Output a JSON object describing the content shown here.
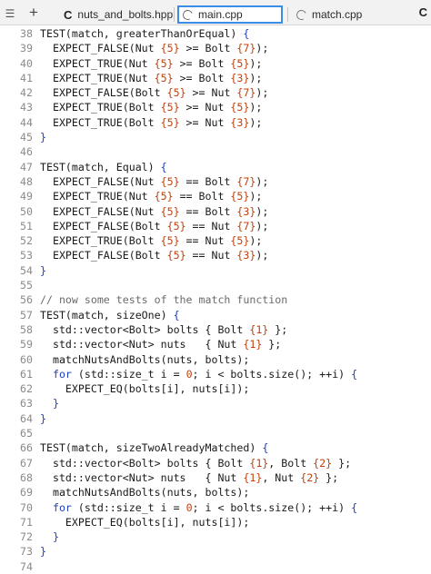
{
  "tabs": {
    "grip_glyph": "☰",
    "add_glyph": "+",
    "items": [
      {
        "label": "nuts_and_bolts.hpp",
        "icon": "c-language-icon"
      },
      {
        "label": "main.cpp",
        "icon": "loading-ring-icon",
        "active": true
      },
      {
        "label": "match.cpp",
        "icon": "loading-ring-icon"
      }
    ],
    "overflow_glyph": "C"
  },
  "editor": {
    "lines": [
      {
        "n": "38",
        "segs": [
          {
            "t": "TEST(match, greaterThanOrEqual) "
          },
          {
            "t": "{",
            "c": "brace"
          }
        ]
      },
      {
        "n": "39",
        "segs": [
          {
            "t": "  EXPECT_FALSE(Nut "
          },
          {
            "t": "{5}",
            "c": "num"
          },
          {
            "t": " >= Bolt "
          },
          {
            "t": "{7}",
            "c": "num"
          },
          {
            "t": ");"
          }
        ]
      },
      {
        "n": "40",
        "segs": [
          {
            "t": "  EXPECT_TRUE(Nut "
          },
          {
            "t": "{5}",
            "c": "num"
          },
          {
            "t": " >= Bolt "
          },
          {
            "t": "{5}",
            "c": "num"
          },
          {
            "t": ");"
          }
        ]
      },
      {
        "n": "41",
        "segs": [
          {
            "t": "  EXPECT_TRUE(Nut "
          },
          {
            "t": "{5}",
            "c": "num"
          },
          {
            "t": " >= Bolt "
          },
          {
            "t": "{3}",
            "c": "num"
          },
          {
            "t": ");"
          }
        ]
      },
      {
        "n": "42",
        "segs": [
          {
            "t": "  EXPECT_FALSE(Bolt "
          },
          {
            "t": "{5}",
            "c": "num"
          },
          {
            "t": " >= Nut "
          },
          {
            "t": "{7}",
            "c": "num"
          },
          {
            "t": ");"
          }
        ]
      },
      {
        "n": "43",
        "segs": [
          {
            "t": "  EXPECT_TRUE(Bolt "
          },
          {
            "t": "{5}",
            "c": "num"
          },
          {
            "t": " >= Nut "
          },
          {
            "t": "{5}",
            "c": "num"
          },
          {
            "t": ");"
          }
        ]
      },
      {
        "n": "44",
        "segs": [
          {
            "t": "  EXPECT_TRUE(Bolt "
          },
          {
            "t": "{5}",
            "c": "num"
          },
          {
            "t": " >= Nut "
          },
          {
            "t": "{3}",
            "c": "num"
          },
          {
            "t": ");"
          }
        ]
      },
      {
        "n": "45",
        "segs": [
          {
            "t": "}",
            "c": "brace"
          }
        ]
      },
      {
        "n": "46",
        "segs": []
      },
      {
        "n": "47",
        "segs": [
          {
            "t": "TEST(match, Equal) "
          },
          {
            "t": "{",
            "c": "brace"
          }
        ]
      },
      {
        "n": "48",
        "segs": [
          {
            "t": "  EXPECT_FALSE(Nut "
          },
          {
            "t": "{5}",
            "c": "num"
          },
          {
            "t": " == Bolt "
          },
          {
            "t": "{7}",
            "c": "num"
          },
          {
            "t": ");"
          }
        ]
      },
      {
        "n": "49",
        "segs": [
          {
            "t": "  EXPECT_TRUE(Nut "
          },
          {
            "t": "{5}",
            "c": "num"
          },
          {
            "t": " == Bolt "
          },
          {
            "t": "{5}",
            "c": "num"
          },
          {
            "t": ");"
          }
        ]
      },
      {
        "n": "50",
        "segs": [
          {
            "t": "  EXPECT_FALSE(Nut "
          },
          {
            "t": "{5}",
            "c": "num"
          },
          {
            "t": " == Bolt "
          },
          {
            "t": "{3}",
            "c": "num"
          },
          {
            "t": ");"
          }
        ]
      },
      {
        "n": "51",
        "segs": [
          {
            "t": "  EXPECT_FALSE(Bolt "
          },
          {
            "t": "{5}",
            "c": "num"
          },
          {
            "t": " == Nut "
          },
          {
            "t": "{7}",
            "c": "num"
          },
          {
            "t": ");"
          }
        ]
      },
      {
        "n": "52",
        "segs": [
          {
            "t": "  EXPECT_TRUE(Bolt "
          },
          {
            "t": "{5}",
            "c": "num"
          },
          {
            "t": " == Nut "
          },
          {
            "t": "{5}",
            "c": "num"
          },
          {
            "t": ");"
          }
        ]
      },
      {
        "n": "53",
        "segs": [
          {
            "t": "  EXPECT_FALSE(Bolt "
          },
          {
            "t": "{5}",
            "c": "num"
          },
          {
            "t": " == Nut "
          },
          {
            "t": "{3}",
            "c": "num"
          },
          {
            "t": ");"
          }
        ]
      },
      {
        "n": "54",
        "segs": [
          {
            "t": "}",
            "c": "brace"
          }
        ]
      },
      {
        "n": "55",
        "segs": []
      },
      {
        "n": "56",
        "segs": [
          {
            "t": "// now some tests of the match function",
            "c": "cm"
          }
        ]
      },
      {
        "n": "57",
        "segs": [
          {
            "t": "TEST(match, sizeOne) "
          },
          {
            "t": "{",
            "c": "brace"
          }
        ]
      },
      {
        "n": "58",
        "segs": [
          {
            "t": "  std::vector<Bolt> bolts { Bolt "
          },
          {
            "t": "{1}",
            "c": "num"
          },
          {
            "t": " };"
          }
        ]
      },
      {
        "n": "59",
        "segs": [
          {
            "t": "  std::vector<Nut> nuts   { Nut "
          },
          {
            "t": "{1}",
            "c": "num"
          },
          {
            "t": " };"
          }
        ]
      },
      {
        "n": "60",
        "segs": [
          {
            "t": "  matchNutsAndBolts(nuts, bolts);"
          }
        ]
      },
      {
        "n": "61",
        "segs": [
          {
            "t": "  "
          },
          {
            "t": "for",
            "c": "kw"
          },
          {
            "t": " (std::size_t i = "
          },
          {
            "t": "0",
            "c": "num"
          },
          {
            "t": "; i < bolts.size(); ++i) "
          },
          {
            "t": "{",
            "c": "brace"
          }
        ]
      },
      {
        "n": "62",
        "segs": [
          {
            "t": "    EXPECT_EQ(bolts[i], nuts[i]);"
          }
        ]
      },
      {
        "n": "63",
        "segs": [
          {
            "t": "  "
          },
          {
            "t": "}",
            "c": "brace"
          }
        ]
      },
      {
        "n": "64",
        "segs": [
          {
            "t": "}",
            "c": "brace"
          }
        ]
      },
      {
        "n": "65",
        "segs": []
      },
      {
        "n": "66",
        "segs": [
          {
            "t": "TEST(match, sizeTwoAlreadyMatched) "
          },
          {
            "t": "{",
            "c": "brace"
          }
        ]
      },
      {
        "n": "67",
        "segs": [
          {
            "t": "  std::vector<Bolt> bolts { Bolt "
          },
          {
            "t": "{1}",
            "c": "num"
          },
          {
            "t": ", Bolt "
          },
          {
            "t": "{2}",
            "c": "num"
          },
          {
            "t": " };"
          }
        ]
      },
      {
        "n": "68",
        "segs": [
          {
            "t": "  std::vector<Nut> nuts   { Nut "
          },
          {
            "t": "{1}",
            "c": "num"
          },
          {
            "t": ", Nut "
          },
          {
            "t": "{2}",
            "c": "num"
          },
          {
            "t": " };"
          }
        ]
      },
      {
        "n": "69",
        "segs": [
          {
            "t": "  matchNutsAndBolts(nuts, bolts);"
          }
        ]
      },
      {
        "n": "70",
        "segs": [
          {
            "t": "  "
          },
          {
            "t": "for",
            "c": "kw"
          },
          {
            "t": " (std::size_t i = "
          },
          {
            "t": "0",
            "c": "num"
          },
          {
            "t": "; i < bolts.size(); ++i) "
          },
          {
            "t": "{",
            "c": "brace"
          }
        ]
      },
      {
        "n": "71",
        "segs": [
          {
            "t": "    EXPECT_EQ(bolts[i], nuts[i]);"
          }
        ]
      },
      {
        "n": "72",
        "segs": [
          {
            "t": "  "
          },
          {
            "t": "}",
            "c": "brace"
          }
        ]
      },
      {
        "n": "73",
        "segs": [
          {
            "t": "}",
            "c": "brace"
          }
        ]
      },
      {
        "n": "74",
        "segs": []
      }
    ]
  },
  "colors": {
    "number": "#c2410c",
    "brace": "#1f3fbf",
    "active_tab_border": "#3a8ee6"
  }
}
